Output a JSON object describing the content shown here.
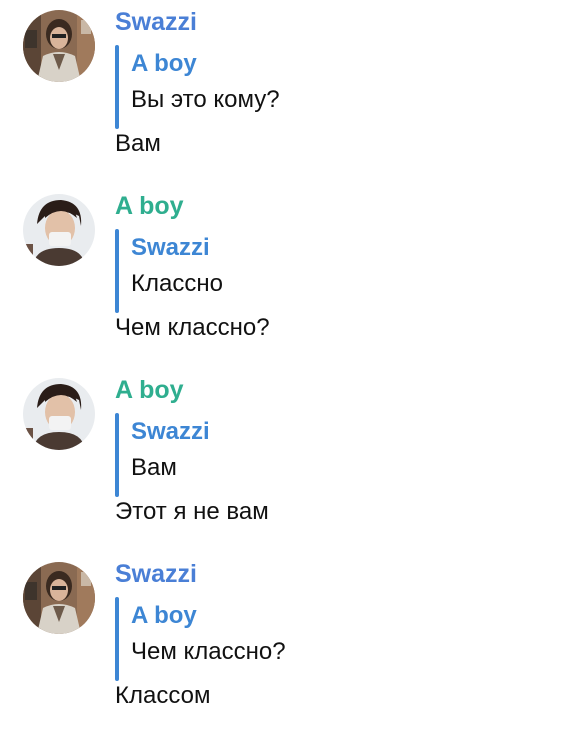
{
  "colors": {
    "swazzi_name": "#4a7fd6",
    "aboy_name": "#2fae8f",
    "reply_bar": "#3d86d4",
    "text": "#111111"
  },
  "messages": [
    {
      "sender": "Swazzi",
      "avatar_icon": "person-photo-icon",
      "reply": {
        "author": "A boy",
        "text": "Вы это кому?"
      },
      "text": "Вам"
    },
    {
      "sender": "A boy",
      "avatar_icon": "person-photo-icon",
      "reply": {
        "author": "Swazzi",
        "text": "Классно"
      },
      "text": "Чем классно?"
    },
    {
      "sender": "A boy",
      "avatar_icon": "person-photo-icon",
      "reply": {
        "author": "Swazzi",
        "text": "Вам"
      },
      "text": "Этот я не вам"
    },
    {
      "sender": "Swazzi",
      "avatar_icon": "person-photo-icon",
      "reply": {
        "author": "A boy",
        "text": "Чем классно?"
      },
      "text": "Классом"
    }
  ]
}
